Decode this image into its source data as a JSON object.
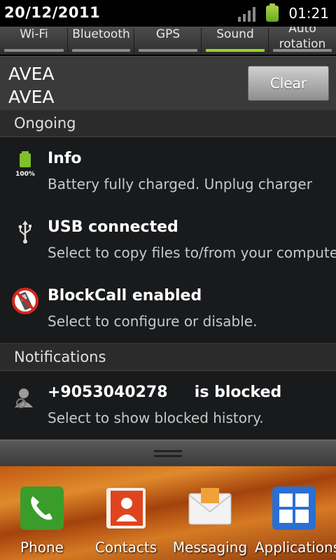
{
  "status_bar": {
    "date": "20/12/2011",
    "time": "01:21"
  },
  "quick_toggles": [
    {
      "label": "Wi-Fi",
      "on": false
    },
    {
      "label": "Bluetooth",
      "on": false
    },
    {
      "label": "GPS",
      "on": false
    },
    {
      "label": "Sound",
      "on": true
    },
    {
      "label": "Auto rotation",
      "on": false
    }
  ],
  "carrier": {
    "line1": "AVEA",
    "line2": "AVEA",
    "clear_label": "Clear"
  },
  "sections": {
    "ongoing": "Ongoing",
    "notifications": "Notifications"
  },
  "ongoing": [
    {
      "title": "Info",
      "subtitle": "Battery fully charged. Unplug charger",
      "icon": "battery-full-icon",
      "icon_text": "100%"
    },
    {
      "title": "USB connected",
      "subtitle": "Select to copy files to/from your computer.",
      "icon": "usb-icon"
    },
    {
      "title": "BlockCall enabled",
      "subtitle": "Select to configure or disable.",
      "icon": "blocked-phone-icon"
    }
  ],
  "notifications": [
    {
      "title": "+9053040278     is blocked",
      "subtitle": "Select to show blocked history.",
      "icon": "blocked-contact-icon"
    }
  ],
  "dock": [
    {
      "label": "Phone",
      "icon": "phone-icon",
      "color": "#3a9c2a"
    },
    {
      "label": "Contacts",
      "icon": "contacts-icon",
      "color": "#e0441f"
    },
    {
      "label": "Messaging",
      "icon": "envelope-icon",
      "color": "#f2f2f2"
    },
    {
      "label": "Applications",
      "icon": "applications-grid-icon",
      "color": "#2a6fd6"
    }
  ]
}
